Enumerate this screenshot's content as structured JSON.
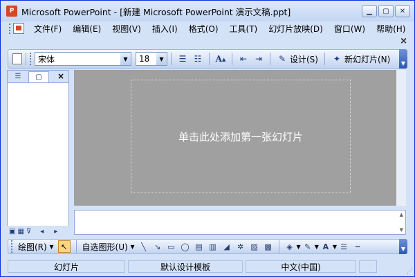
{
  "window": {
    "title": "Microsoft PowerPoint - [新建 Microsoft PowerPoint 演示文稿.ppt]",
    "app_icon": "powerpoint-icon"
  },
  "menu": {
    "items": [
      "文件(F)",
      "编辑(E)",
      "视图(V)",
      "插入(I)",
      "格式(O)",
      "工具(T)",
      "幻灯片放映(D)",
      "窗口(W)",
      "帮助(H)"
    ],
    "close_glyph": "×"
  },
  "toolbar": {
    "font_name": "宋体",
    "font_size": "18",
    "design_label": "设计(S)",
    "new_slide_label": "新幻灯片(N)"
  },
  "slide": {
    "placeholder_text": "单击此处添加第一张幻灯片",
    "background_color": "#a0a0a0"
  },
  "drawbar": {
    "draw_label": "绘图(R)",
    "autoshapes_label": "自选图形(U)"
  },
  "status": {
    "slide": "幻灯片",
    "template": "默认设计模板",
    "language": "中文(中国)"
  }
}
